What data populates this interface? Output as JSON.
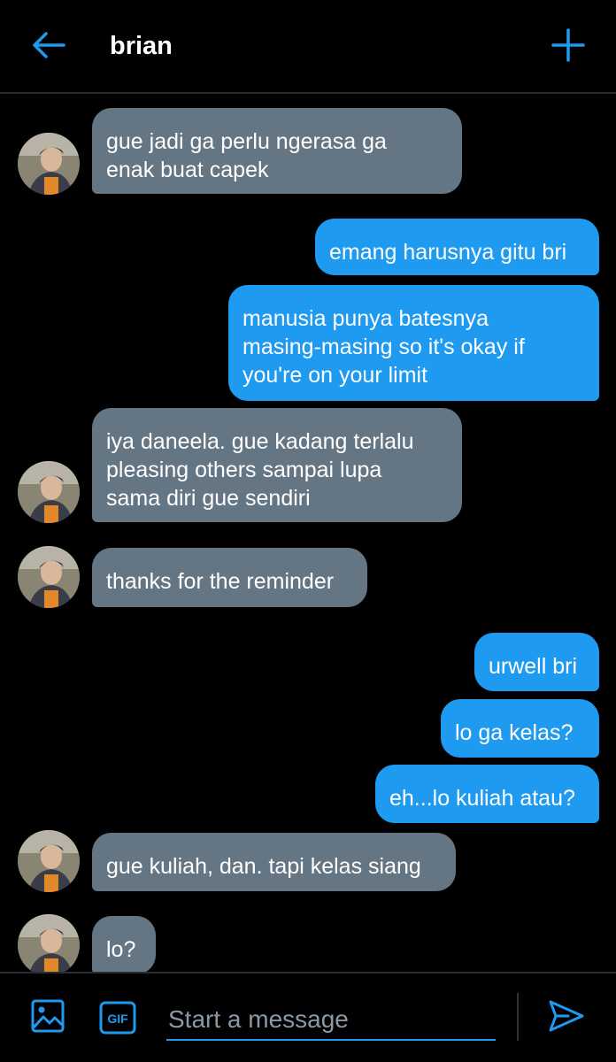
{
  "header": {
    "title": "brian",
    "back_icon": "arrow-left-icon",
    "add_icon": "plus-icon"
  },
  "colors": {
    "accent": "#1e9af0",
    "incoming_bubble": "#647583",
    "background": "#000000"
  },
  "messages": [
    {
      "side": "in",
      "lines": [
        "gue jadi ga perlu ngerasa ga",
        "enak buat capek"
      ],
      "avatar": true
    },
    {
      "side": "out",
      "lines": [
        "emang harusnya gitu bri"
      ]
    },
    {
      "side": "out",
      "lines": [
        "manusia punya batesnya",
        "masing-masing so it's okay if",
        "you're on your limit"
      ]
    },
    {
      "side": "in",
      "lines": [
        "iya daneela. gue kadang terlalu",
        "pleasing others sampai lupa",
        "sama diri gue sendiri"
      ],
      "avatar": true
    },
    {
      "side": "in",
      "lines": [
        "thanks for the reminder"
      ],
      "avatar": true
    },
    {
      "side": "out",
      "lines": [
        "urwell bri"
      ]
    },
    {
      "side": "out",
      "lines": [
        "lo ga kelas?"
      ]
    },
    {
      "side": "out",
      "lines": [
        "eh...lo kuliah atau?"
      ]
    },
    {
      "side": "in",
      "lines": [
        "gue kuliah, dan. tapi kelas siang"
      ],
      "avatar": true
    },
    {
      "side": "in",
      "lines": [
        "lo?"
      ],
      "avatar": true
    }
  ],
  "composer": {
    "placeholder": "Start a message",
    "value": "",
    "image_icon": "image-icon",
    "gif_label": "GIF",
    "send_icon": "send-icon"
  }
}
